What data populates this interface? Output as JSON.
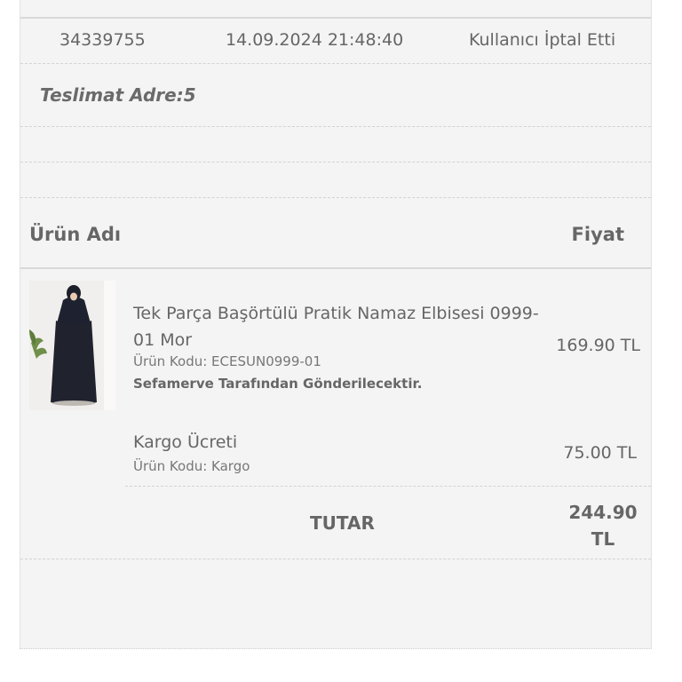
{
  "order": {
    "number": "34339755",
    "date": "14.09.2024 21:48:40",
    "status": "Kullanıcı İptal Etti"
  },
  "delivery": {
    "address_label": "Teslimat Adre:5"
  },
  "table": {
    "header_name": "Ürün Adı",
    "header_price": "Fiyat"
  },
  "items": [
    {
      "title": "Tek Parça Başörtülü Pratik Namaz Elbisesi 0999-01 Mor",
      "code": "Ürün Kodu: ECESUN0999-01",
      "seller": "Sefamerve Tarafından Gönderilecektir.",
      "price": "169.90 TL",
      "image_icon": "product-photo-dress"
    }
  ],
  "cargo": {
    "title": "Kargo Ücreti",
    "code": "Ürün Kodu: Kargo",
    "price": "75.00 TL"
  },
  "total": {
    "label": "TUTAR",
    "value": "244.90 TL"
  },
  "colors": {
    "panel_bg": "#f4f4f4",
    "text": "#666666",
    "divider": "#d3d3d3"
  }
}
